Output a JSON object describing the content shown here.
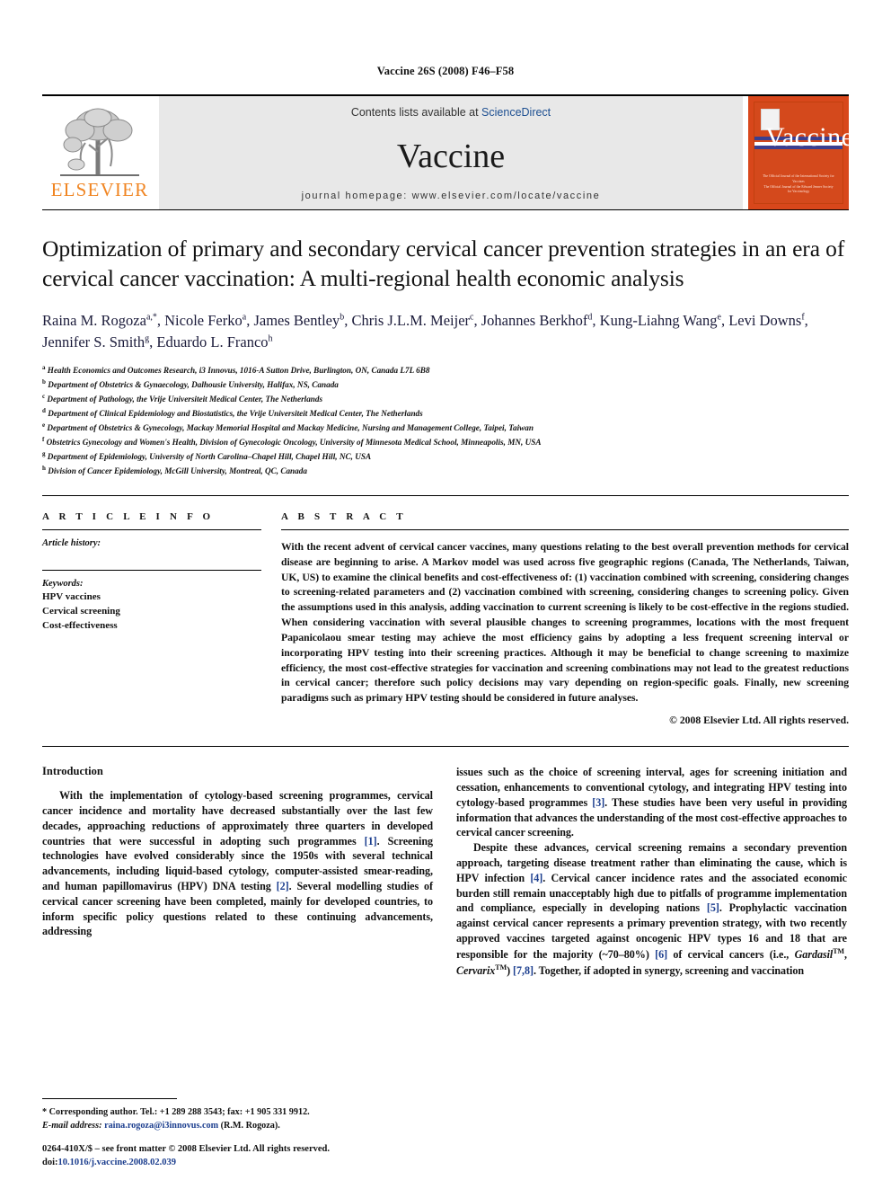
{
  "running_head": "Vaccine 26S (2008) F46–F58",
  "masthead": {
    "publisher_name": "ELSEVIER",
    "contents_prefix": "Contents lists available at ",
    "contents_link": "ScienceDirect",
    "journal_name": "Vaccine",
    "homepage": "journal homepage: www.elsevier.com/locate/vaccine",
    "cover_title": "Vaccine",
    "cover_footer": "The Official Journal of the International Society for Vaccines\nThe Official Journal of the Edward Jenner Society for Vaccinology"
  },
  "article": {
    "title": "Optimization of primary and secondary cervical cancer prevention strategies in an era of cervical cancer vaccination: A multi-regional health economic analysis",
    "authors": [
      {
        "name": "Raina M. Rogoza",
        "sup": "a,*"
      },
      {
        "name": "Nicole Ferko",
        "sup": "a"
      },
      {
        "name": "James Bentley",
        "sup": "b"
      },
      {
        "name": "Chris J.L.M. Meijer",
        "sup": "c"
      },
      {
        "name": "Johannes Berkhof",
        "sup": "d"
      },
      {
        "name": "Kung-Liahng Wang",
        "sup": "e"
      },
      {
        "name": "Levi Downs",
        "sup": "f"
      },
      {
        "name": "Jennifer S. Smith",
        "sup": "g"
      },
      {
        "name": "Eduardo L. Franco",
        "sup": "h"
      }
    ],
    "affiliations": [
      {
        "label": "a",
        "text": "Health Economics and Outcomes Research, i3 Innovus, 1016-A Sutton Drive, Burlington, ON, Canada L7L 6B8"
      },
      {
        "label": "b",
        "text": "Department of Obstetrics & Gynaecology, Dalhousie University, Halifax, NS, Canada"
      },
      {
        "label": "c",
        "text": "Department of Pathology, the Vrije Universiteit Medical Center, The Netherlands"
      },
      {
        "label": "d",
        "text": "Department of Clinical Epidemiology and Biostatistics, the Vrije Universiteit Medical Center, The Netherlands"
      },
      {
        "label": "e",
        "text": "Department of Obstetrics & Gynecology, Mackay Memorial Hospital and Mackay Medicine, Nursing and Management College, Taipei, Taiwan"
      },
      {
        "label": "f",
        "text": "Obstetrics Gynecology and Women's Health, Division of Gynecologic Oncology, University of Minnesota Medical School, Minneapolis, MN, USA"
      },
      {
        "label": "g",
        "text": "Department of Epidemiology, University of North Carolina–Chapel Hill, Chapel Hill, NC, USA"
      },
      {
        "label": "h",
        "text": "Division of Cancer Epidemiology, McGill University, Montreal, QC, Canada"
      }
    ]
  },
  "article_info": {
    "heading": "A R T I C L E   I N F O",
    "history_label": "Article history:",
    "keywords_label": "Keywords:",
    "keywords": [
      "HPV vaccines",
      "Cervical screening",
      "Cost-effectiveness"
    ]
  },
  "abstract": {
    "heading": "A B S T R A C T",
    "text": "With the recent advent of cervical cancer vaccines, many questions relating to the best overall prevention methods for cervical disease are beginning to arise. A Markov model was used across five geographic regions (Canada, The Netherlands, Taiwan, UK, US) to examine the clinical benefits and cost-effectiveness of: (1) vaccination combined with screening, considering changes to screening-related parameters and (2) vaccination combined with screening, considering changes to screening policy. Given the assumptions used in this analysis, adding vaccination to current screening is likely to be cost-effective in the regions studied. When considering vaccination with several plausible changes to screening programmes, locations with the most frequent Papanicolaou smear testing may achieve the most efficiency gains by adopting a less frequent screening interval or incorporating HPV testing into their screening practices. Although it may be beneficial to change screening to maximize efficiency, the most cost-effective strategies for vaccination and screening combinations may not lead to the greatest reductions in cervical cancer; therefore such policy decisions may vary depending on region-specific goals. Finally, new screening paradigms such as primary HPV testing should be considered in future analyses.",
    "copyright": "© 2008 Elsevier Ltd. All rights reserved."
  },
  "body": {
    "section_heading": "Introduction",
    "left_para_1_a": "With the implementation of cytology-based screening programmes, cervical cancer incidence and mortality have decreased substantially over the last few decades, approaching reductions of approximately three quarters in developed countries that were successful in adopting such programmes ",
    "left_ref_1": "[1]",
    "left_para_1_b": ". Screening technologies have evolved considerably since the 1950s with several technical advancements, including liquid-based cytology, computer-assisted smear-reading, and human papillomavirus (HPV) DNA testing ",
    "left_ref_2": "[2]",
    "left_para_1_c": ". Several modelling studies of cervical cancer screening have been completed, mainly for developed countries, to inform specific policy questions related to these continuing advancements, addressing",
    "right_para_1_a": "issues such as the choice of screening interval, ages for screening initiation and cessation, enhancements to conventional cytology, and integrating HPV testing into cytology-based programmes ",
    "right_ref_3": "[3]",
    "right_para_1_b": ". These studies have been very useful in providing information that advances the understanding of the most cost-effective approaches to cervical cancer screening.",
    "right_para_2_a": "Despite these advances, cervical screening remains a secondary prevention approach, targeting disease treatment rather than eliminating the cause, which is HPV infection ",
    "right_ref_4": "[4]",
    "right_para_2_b": ". Cervical cancer incidence rates and the associated economic burden still remain unacceptably high due to pitfalls of programme implementation and compliance, especially in developing nations ",
    "right_ref_5": "[5]",
    "right_para_2_c": ". Prophylactic vaccination against cervical cancer represents a primary prevention strategy, with two recently approved vaccines targeted against oncogenic HPV types 16 and 18 that are responsible for the majority (~70–80%) ",
    "right_ref_6": "[6]",
    "right_para_2_d": " of cervical cancers (i.e., ",
    "right_brand_1": "Gardasil",
    "right_para_2_e": ", ",
    "right_brand_2": "Cervarix",
    "right_para_2_f": ") ",
    "right_ref_78": "[7,8]",
    "right_para_2_g": ". Together, if adopted in synergy, screening and vaccination",
    "tm_symbol": "TM"
  },
  "footnotes": {
    "corresponding": "* Corresponding author. Tel.: +1 289 288 3543; fax: +1 905 331 9912.",
    "email_label": "E-mail address:",
    "email": "raina.rogoza@i3innovus.com",
    "email_attrib": "(R.M. Rogoza).",
    "issn_line": "0264-410X/$ – see front matter © 2008 Elsevier Ltd. All rights reserved.",
    "doi_label": "doi:",
    "doi_value": "10.1016/j.vaccine.2008.02.039"
  },
  "colors": {
    "elsevier_orange": "#F08522",
    "link_blue": "#1d4f91",
    "reference_blue": "#1d3f8f",
    "cover_orange": "#D4491C"
  }
}
